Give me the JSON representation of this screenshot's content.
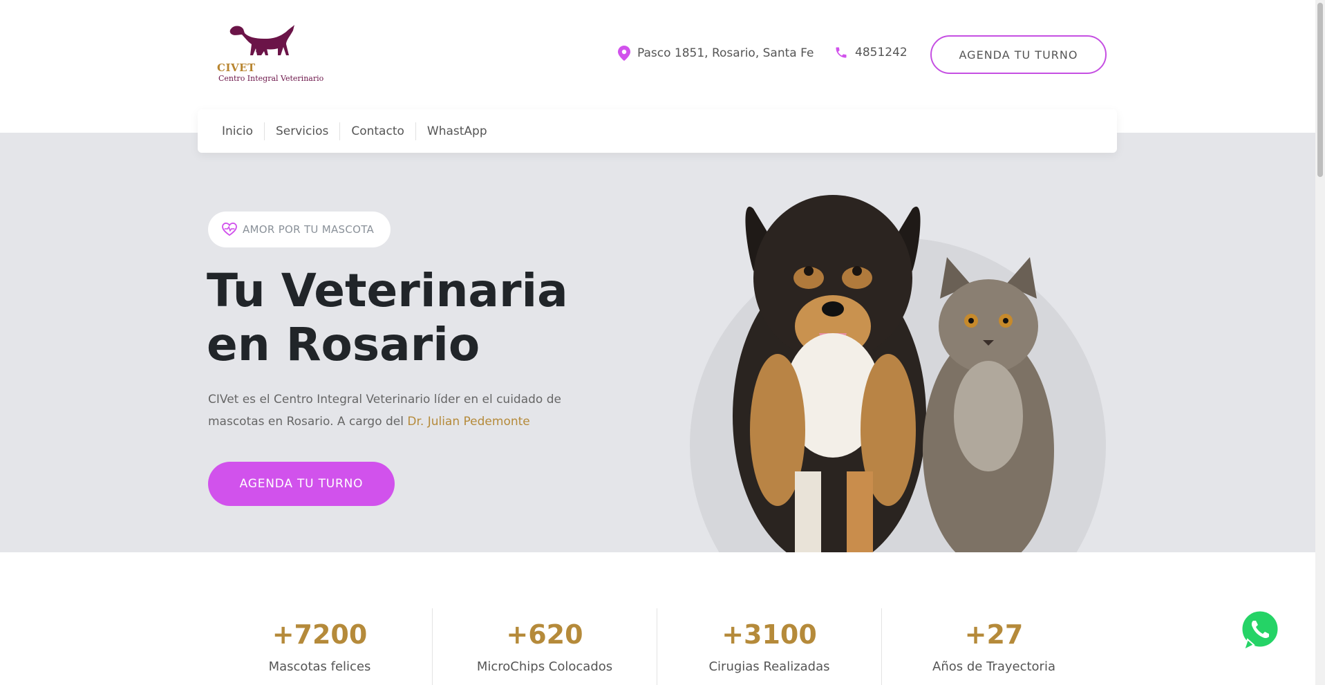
{
  "brand": {
    "name": "CIVET",
    "tagline": "Centro Integral Veterinario"
  },
  "header": {
    "address": "Pasco 1851, Rosario, Santa Fe",
    "phone": "4851242",
    "cta_label": "AGENDA TU TURNO"
  },
  "nav": {
    "items": [
      "Inicio",
      "Servicios",
      "Contacto",
      "WhastApp"
    ]
  },
  "hero": {
    "badge": "AMOR POR TU MASCOTA",
    "title": "Tu Veterinaria en Rosario",
    "description": "CIVet es el Centro Integral Veterinario líder en el cuidado de mascotas en Rosario. A cargo del ",
    "doctor": "Dr. Julian Pedemonte",
    "cta_label": "AGENDA TU TURNO"
  },
  "stats": [
    {
      "value": "+7200",
      "label": "Mascotas felices"
    },
    {
      "value": "+620",
      "label": "MicroChips Colocados"
    },
    {
      "value": "+3100",
      "label": "Cirugias Realizadas"
    },
    {
      "value": "+27",
      "label": "Años de Trayectoria"
    }
  ],
  "colors": {
    "accent": "#d152ec",
    "gold": "#b58a3a",
    "logo_purple": "#6b1448",
    "hero_bg": "#e4e5e9"
  },
  "icons": {
    "address": "map-pin-icon",
    "phone": "phone-icon",
    "badge": "heart-pulse-icon",
    "floating": "whatsapp-icon"
  }
}
